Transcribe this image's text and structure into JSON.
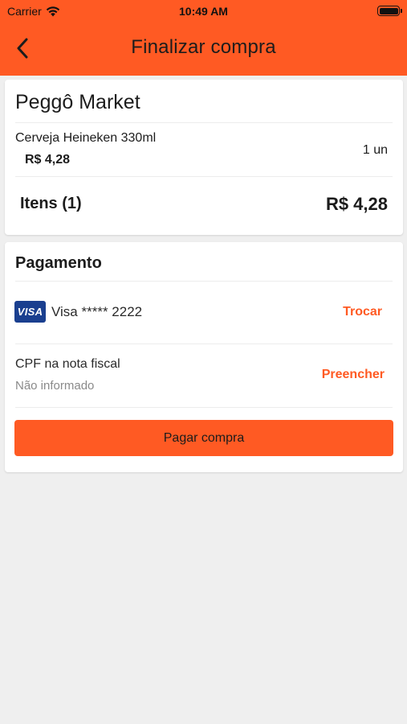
{
  "status_bar": {
    "carrier": "Carrier",
    "time": "10:49 AM",
    "wifi_icon": "wifi-icon",
    "battery_icon": "battery-icon"
  },
  "header": {
    "title": "Finalizar compra",
    "back_icon": "chevron-left-icon",
    "background_color": "#ff5a23"
  },
  "order": {
    "store_name": "Peggô Market",
    "item": {
      "name": "Cerveja Heineken 330ml",
      "price": "R$ 4,28",
      "quantity": "1 un"
    },
    "items_label": "Itens (1)",
    "items_total": "R$ 4,28"
  },
  "payment": {
    "title": "Pagamento",
    "card_brand": "VISA",
    "card_number": "Visa ***** 2222",
    "change_label": "Trocar",
    "cpf_label": "CPF na nota fiscal",
    "cpf_value": "Não informado",
    "fill_label": "Preencher",
    "pay_button_label": "Pagar compra"
  },
  "colors": {
    "accent": "#ff5a23",
    "visa_blue": "#1a3f8f",
    "background": "#efefef"
  }
}
